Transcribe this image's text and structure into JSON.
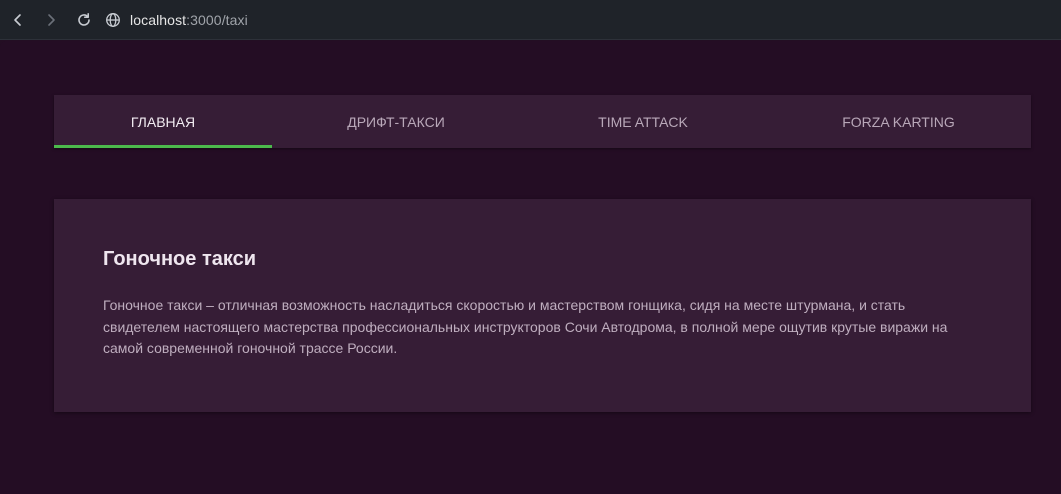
{
  "browser": {
    "url_host": "localhost",
    "url_path": ":3000/taxi"
  },
  "icons": {
    "back": "arrow-left-icon",
    "forward": "arrow-right-icon",
    "reload": "reload-icon",
    "site": "globe-icon"
  },
  "tabs": [
    {
      "label": "ГЛАВНАЯ",
      "active": true
    },
    {
      "label": "ДРИФТ-ТАКСИ",
      "active": false
    },
    {
      "label": "TIME ATTACK",
      "active": false
    },
    {
      "label": "FORZA KARTING",
      "active": false
    }
  ],
  "card": {
    "title": "Гоночное такси",
    "text": "Гоночное такси – отличная возможность насладиться скоростью и мастерством гонщика, сидя на месте штурмана, и стать свидетелем настоящего мастерства профессиональных инструкторов Сочи Автодрома, в полной мере ощутив крутые виражи на самой современной гоночной трассе России."
  },
  "colors": {
    "background": "#240d24",
    "panel": "#361d36",
    "active_indicator": "#4cba4c"
  }
}
